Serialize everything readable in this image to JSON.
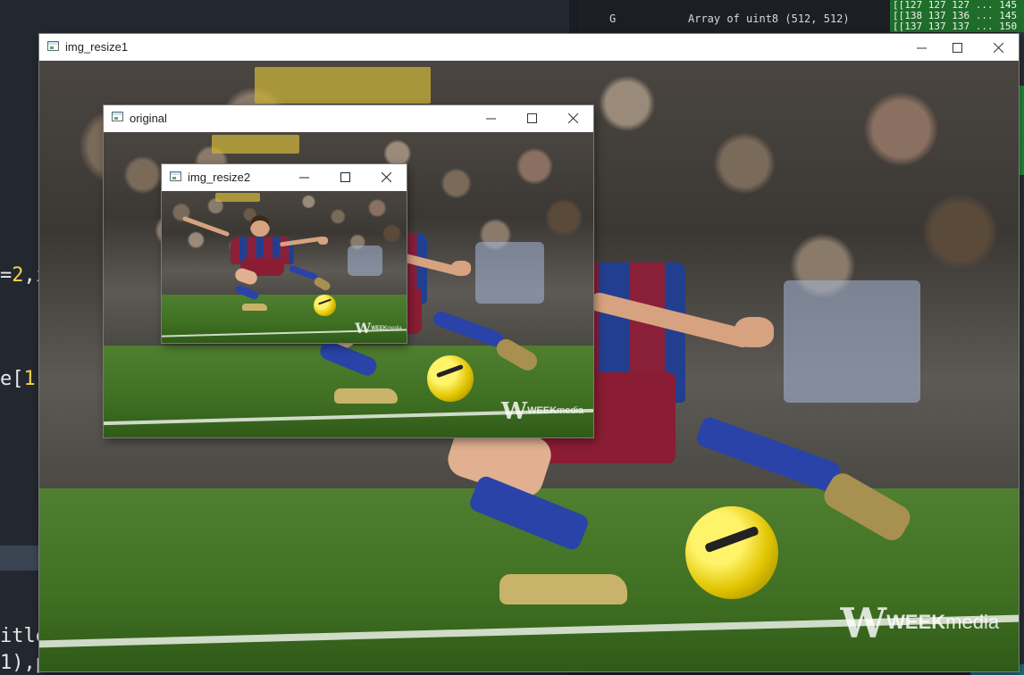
{
  "background_ide": {
    "code_lines": [
      {
        "prefix": "=",
        "number": "2",
        "suffix": ",i"
      },
      {
        "prefix": "e[",
        "number": "1",
        "suffix": "]"
      },
      {
        "prefix": "itle",
        "number": "",
        "suffix": ""
      },
      {
        "prefix": "1),p",
        "number": "",
        "suffix": ""
      }
    ],
    "variable_explorer": {
      "name": "G",
      "type_and_size": "Array of uint8  (512, 512)",
      "value_lines": [
        "[[127 127 127 ... 145",
        "[[138 137 136 ... 145",
        "[[137 137 137 ... 150"
      ]
    }
  },
  "windows": {
    "img_resize1": {
      "title": "img_resize1"
    },
    "original": {
      "title": "original"
    },
    "img_resize2": {
      "title": "img_resize2"
    }
  },
  "watermark": {
    "prefix": "WEEK",
    "suffix": "media"
  },
  "colors": {
    "ide_bg": "#232830",
    "code_number": "#f4d24a",
    "variable_value_bg": "#1f6d2a",
    "window_titlebar": "#ffffff"
  },
  "icons": [
    "app-window-icon",
    "minimize-icon",
    "maximize-icon",
    "close-icon"
  ]
}
